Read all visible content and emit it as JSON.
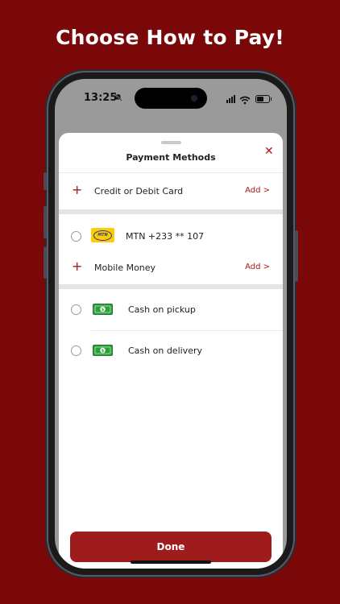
{
  "headline": "Choose How to Pay!",
  "status": {
    "time": "13:25"
  },
  "sheet": {
    "title": "Payment Methods",
    "close_glyph": "✕",
    "card_row": {
      "plus": "+",
      "label": "Credit or Debit Card",
      "action": "Add >"
    },
    "mtn_row": {
      "logo_text": "MTN",
      "label": "MTN +233 ** 107"
    },
    "momo_row": {
      "plus": "+",
      "label": "Mobile Money",
      "action": "Add >"
    },
    "cash_pickup": {
      "label": "Cash on pickup",
      "icon": "cash-icon"
    },
    "cash_delivery": {
      "label": "Cash on delivery",
      "icon": "cash-icon"
    },
    "done_label": "Done"
  },
  "colors": {
    "background": "#7a0808",
    "accent": "#a31b1b",
    "button": "#9e1c1c",
    "mtn_yellow": "#ffcb05",
    "cash_green": "#2e9e3a"
  }
}
